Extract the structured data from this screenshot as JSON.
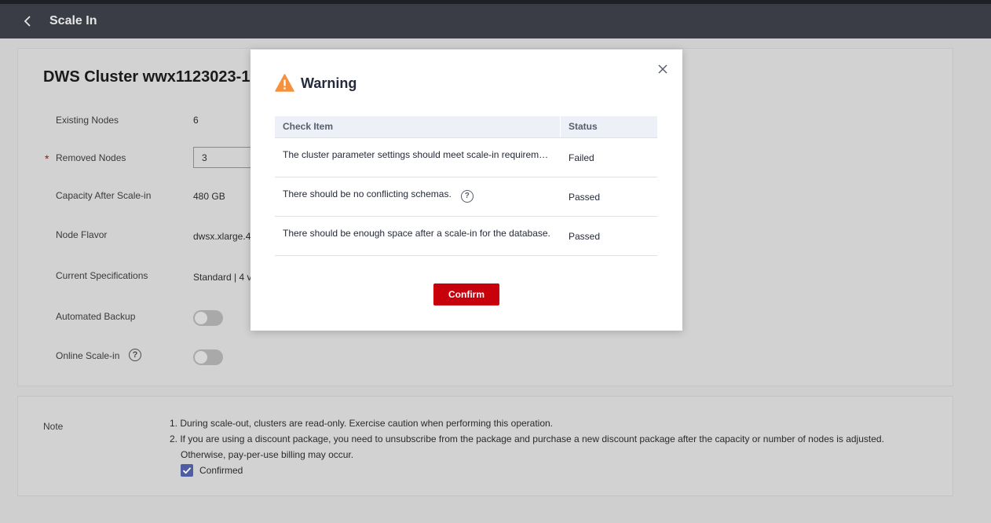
{
  "header": {
    "title": "Scale In"
  },
  "form": {
    "cluster_title": "DWS Cluster wwx1123023-1",
    "existing_nodes_label": "Existing Nodes",
    "existing_nodes_value": "6",
    "removed_nodes_label": "Removed Nodes",
    "removed_nodes_value": "3",
    "capacity_label": "Capacity After Scale-in",
    "capacity_value": "480 GB",
    "node_flavor_label": "Node Flavor",
    "node_flavor_value": "dwsx.xlarge.4",
    "current_spec_label": "Current Specifications",
    "current_spec_value": "Standard | 4 v",
    "automated_backup_label": "Automated Backup",
    "automated_backup_on": false,
    "online_scalein_label": "Online Scale-in",
    "online_scalein_on": false
  },
  "note": {
    "label": "Note",
    "line1": "1. During scale-out, clusters are read-only. Exercise caution when performing this operation.",
    "line2": "2. If you are using a discount package, you need to unsubscribe from the package and purchase a new discount package after the capacity or number of nodes is adjusted.",
    "line3": "Otherwise, pay-per-use billing may occur.",
    "confirmed_label": "Confirmed",
    "confirmed_checked": true
  },
  "modal": {
    "title": "Warning",
    "columns": [
      "Check Item",
      "Status"
    ],
    "rows": [
      {
        "item": "The cluster parameter settings should meet scale-in requirements.",
        "status": "Failed"
      },
      {
        "item": "There should be no conflicting schemas.",
        "status": "Passed"
      },
      {
        "item": "There should be enough space after a scale-in for the database.",
        "status": "Passed"
      }
    ],
    "confirm_label": "Confirm"
  },
  "colors": {
    "accent": "#c7000b",
    "warning": "#f5903d",
    "header_bg": "#3a3d46",
    "checkbox": "#4f5ea4"
  }
}
